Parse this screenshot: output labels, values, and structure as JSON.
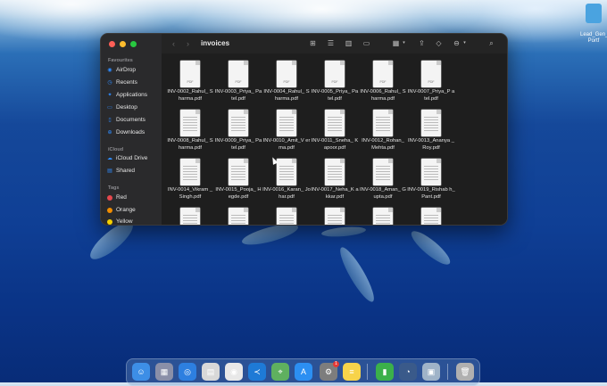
{
  "desktop": {
    "icon_label": "Lead_Gen_ Portf"
  },
  "finder": {
    "title": "invoices",
    "sidebar": {
      "favourites_header": "Favourites",
      "favourites": [
        {
          "label": "AirDrop",
          "icon": "airdrop-icon"
        },
        {
          "label": "Recents",
          "icon": "clock-icon"
        },
        {
          "label": "Applications",
          "icon": "applications-icon"
        },
        {
          "label": "Desktop",
          "icon": "desktop-icon"
        },
        {
          "label": "Documents",
          "icon": "document-icon"
        },
        {
          "label": "Downloads",
          "icon": "download-icon"
        }
      ],
      "icloud_header": "iCloud",
      "icloud": [
        {
          "label": "iCloud Drive",
          "icon": "cloud-icon"
        },
        {
          "label": "Shared",
          "icon": "shared-folder-icon"
        }
      ],
      "tags_header": "Tags",
      "tags": [
        {
          "label": "Red",
          "color": "#e5484d"
        },
        {
          "label": "Orange",
          "color": "#f08c00"
        },
        {
          "label": "Yellow",
          "color": "#f5d000"
        }
      ]
    },
    "file_tag": "PDF",
    "files": [
      "INV-0002_Rahul_ Sharma.pdf",
      "INV-0003_Priya_ Patel.pdf",
      "INV-0004_Rahul_ Sharma.pdf",
      "INV-0005_Priya_ Patel.pdf",
      "INV-0006_Rahul_ Sharma.pdf",
      "INV-0007_Priya_P atel.pdf",
      "INV-0008_Rahul_ Sharma.pdf",
      "INV-0009_Priya_ Patel.pdf",
      "INV-0010_Amit_V erma.pdf",
      "INV-0011_Sneha_ Kapoor.pdf",
      "INV-0012_Rohan_ Mehta.pdf",
      "INV-0013_Ananya _Roy.pdf",
      "INV-0014_Vikram _Singh.pdf",
      "INV-0015_Pooja_ Hegde.pdf",
      "INV-0016_Karan_ Johar.pdf",
      "INV-0017_Neha_K akkar.pdf",
      "INV-0018_Aman_ Gupta.pdf",
      "INV-0019_Rishab h_Pant.pdf"
    ]
  },
  "dock": {
    "apps": [
      {
        "name": "finder-icon",
        "color": "#3d8ee6",
        "glyph": "☺"
      },
      {
        "name": "launchpad-icon",
        "color": "#8a8fa8",
        "glyph": "▦"
      },
      {
        "name": "safari-icon",
        "color": "#2d7fe0",
        "glyph": "◎"
      },
      {
        "name": "preview-icon",
        "color": "#d8d8d8",
        "glyph": "▤"
      },
      {
        "name": "chrome-icon",
        "color": "#e8e8e8",
        "glyph": "◉"
      },
      {
        "name": "vscode-icon",
        "color": "#1e7ad6",
        "glyph": "≺"
      },
      {
        "name": "maps-icon",
        "color": "#5fb05f",
        "glyph": "⌖"
      },
      {
        "name": "app-store-icon",
        "color": "#2c8ff2",
        "glyph": "A"
      },
      {
        "name": "system-settings-icon",
        "color": "#7d7d7d",
        "glyph": "⚙",
        "badge": "1"
      },
      {
        "name": "notes-icon",
        "color": "#f7d34a",
        "glyph": "≡"
      },
      {
        "name": "numbers-icon",
        "color": "#3bb04a",
        "glyph": "▮"
      },
      {
        "name": "quicktime-icon",
        "color": "#3a5a8a",
        "glyph": "◔"
      },
      {
        "name": "preview-viewer-icon",
        "color": "#9fb3c8",
        "glyph": "▣"
      },
      {
        "name": "trash-icon",
        "color": "#b0b0b0",
        "glyph": "🗑"
      }
    ]
  }
}
